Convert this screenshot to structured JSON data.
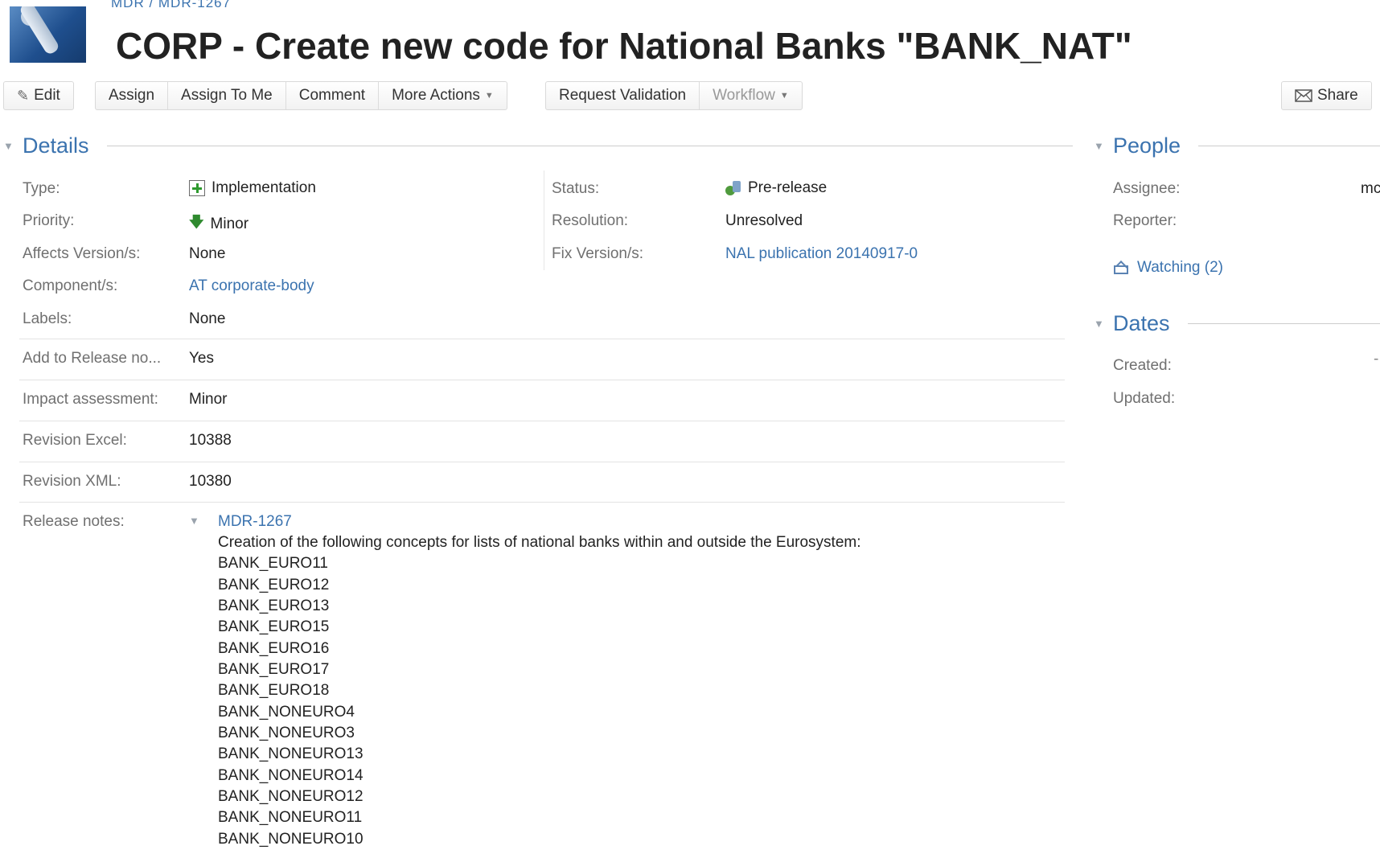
{
  "header": {
    "breadcrumb": "MDR / MDR-1267",
    "title": "CORP - Create new code for National Banks \"BANK_NAT\""
  },
  "toolbar": {
    "edit": "Edit",
    "assign": "Assign",
    "assign_to_me": "Assign To Me",
    "comment": "Comment",
    "more_actions": "More Actions",
    "request_validation": "Request Validation",
    "workflow": "Workflow",
    "share": "Share"
  },
  "details": {
    "title": "Details",
    "type": {
      "label": "Type:",
      "value": "Implementation",
      "icon": "implementation-icon"
    },
    "priority": {
      "label": "Priority:",
      "value": "Minor",
      "icon": "arrow-down-icon"
    },
    "affects_versions": {
      "label": "Affects Version/s:",
      "value": "None"
    },
    "components": {
      "label": "Component/s:",
      "value": "AT corporate-body"
    },
    "labels": {
      "label": "Labels:",
      "value": "None"
    },
    "status": {
      "label": "Status:",
      "value": "Pre-release",
      "icon": "status-icon"
    },
    "resolution": {
      "label": "Resolution:",
      "value": "Unresolved"
    },
    "fix_versions": {
      "label": "Fix Version/s:",
      "value": "NAL publication 20140917-0"
    },
    "add_to_release": {
      "label": "Add to Release no...",
      "value": "Yes"
    },
    "impact_assessment": {
      "label": "Impact assessment:",
      "value": "Minor"
    },
    "revision_excel": {
      "label": "Revision Excel:",
      "value": "10388"
    },
    "revision_xml": {
      "label": "Revision XML:",
      "value": "10380"
    },
    "release_notes": {
      "label": "Release notes:",
      "key": "MDR-1267",
      "lines": [
        "Creation of the following concepts for lists of national banks within and outside the Eurosystem:",
        "BANK_EURO11",
        "BANK_EURO12",
        "BANK_EURO13",
        "BANK_EURO15",
        "BANK_EURO16",
        "BANK_EURO17",
        "BANK_EURO18",
        "BANK_NONEURO4",
        "BANK_NONEURO3",
        "BANK_NONEURO13",
        "BANK_NONEURO14",
        "BANK_NONEURO12",
        "BANK_NONEURO11",
        "BANK_NONEURO10"
      ]
    }
  },
  "people": {
    "title": "People",
    "assignee_label": "Assignee:",
    "assignee_value": "mc",
    "reporter_label": "Reporter:",
    "watching": "Watching (2)"
  },
  "dates": {
    "title": "Dates",
    "created_label": "Created:",
    "created_value": "-",
    "updated_label": "Updated:"
  },
  "colors": {
    "link": "#3b73af",
    "title": "#222222",
    "label": "#707070"
  }
}
